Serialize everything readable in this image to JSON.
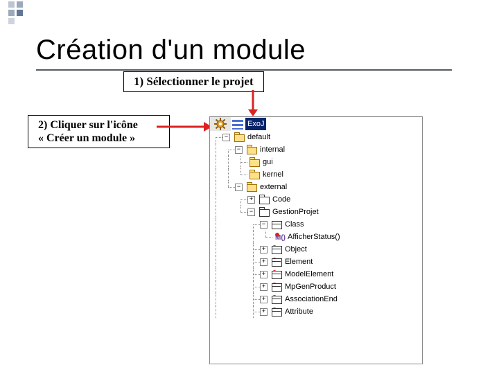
{
  "title": "Création d'un module",
  "callout1": "1) Sélectionner le projet",
  "callout2_line1": "2) Cliquer sur l'icône",
  "callout2_line2": "« Créer un module »",
  "expand_plus": "+",
  "expand_minus": "−",
  "tree": {
    "root": "ExoJ",
    "n_default": "default",
    "n_internal": "internal",
    "n_gui": "gui",
    "n_kernel": "kernel",
    "n_external": "external",
    "n_code": "Code",
    "n_gestion": "GestionProjet",
    "n_class": "Class",
    "n_afficher": "AfficherStatus()",
    "n_object": "Object",
    "n_element": "Element",
    "n_modelelement": "ModelElement",
    "n_mpgen": "MpGenProduct",
    "n_assoc": "AssociationEnd",
    "n_attribute": "Attribute"
  }
}
